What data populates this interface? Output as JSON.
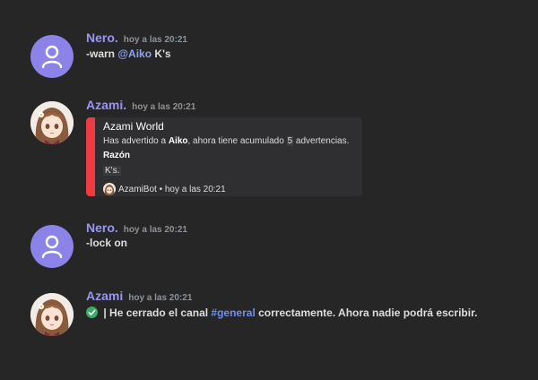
{
  "messages": [
    {
      "username": "Nero.",
      "timestamp": "hoy a las 20:21",
      "text_prefix": "-warn ",
      "mention": "@Aiko",
      "text_suffix": " K's"
    },
    {
      "username": "Azami.",
      "timestamp": "hoy a las 20:21",
      "embed": {
        "title": "Azami World",
        "desc_prefix": "Has advertido a ",
        "desc_user": "Aiko",
        "desc_middle": ", ahora tiene acumulado ",
        "desc_count": "5",
        "desc_suffix": " advertencias.",
        "field_name": "Razón",
        "field_value": "K's.",
        "footer": "AzamiBot • hoy a las 20:21",
        "accent_color": "#ee3b43"
      }
    },
    {
      "username": "Nero.",
      "timestamp": "hoy a las 20:21",
      "text": "-lock on"
    },
    {
      "username": "Azami",
      "timestamp": "hoy a las 20:21",
      "text_prefix": " | He cerrado el canal ",
      "channel": "#general",
      "text_suffix": " correctamente. Ahora nadie podrá escribir."
    }
  ],
  "icons": {
    "default_avatar": "user-silhouette-icon",
    "success": "check-circle-icon"
  },
  "colors": {
    "background": "#262626",
    "username": "#9a95f2",
    "default_avatar_bg": "#8c83e8",
    "mention": "#8ea1f5",
    "check": "#3fa864"
  }
}
